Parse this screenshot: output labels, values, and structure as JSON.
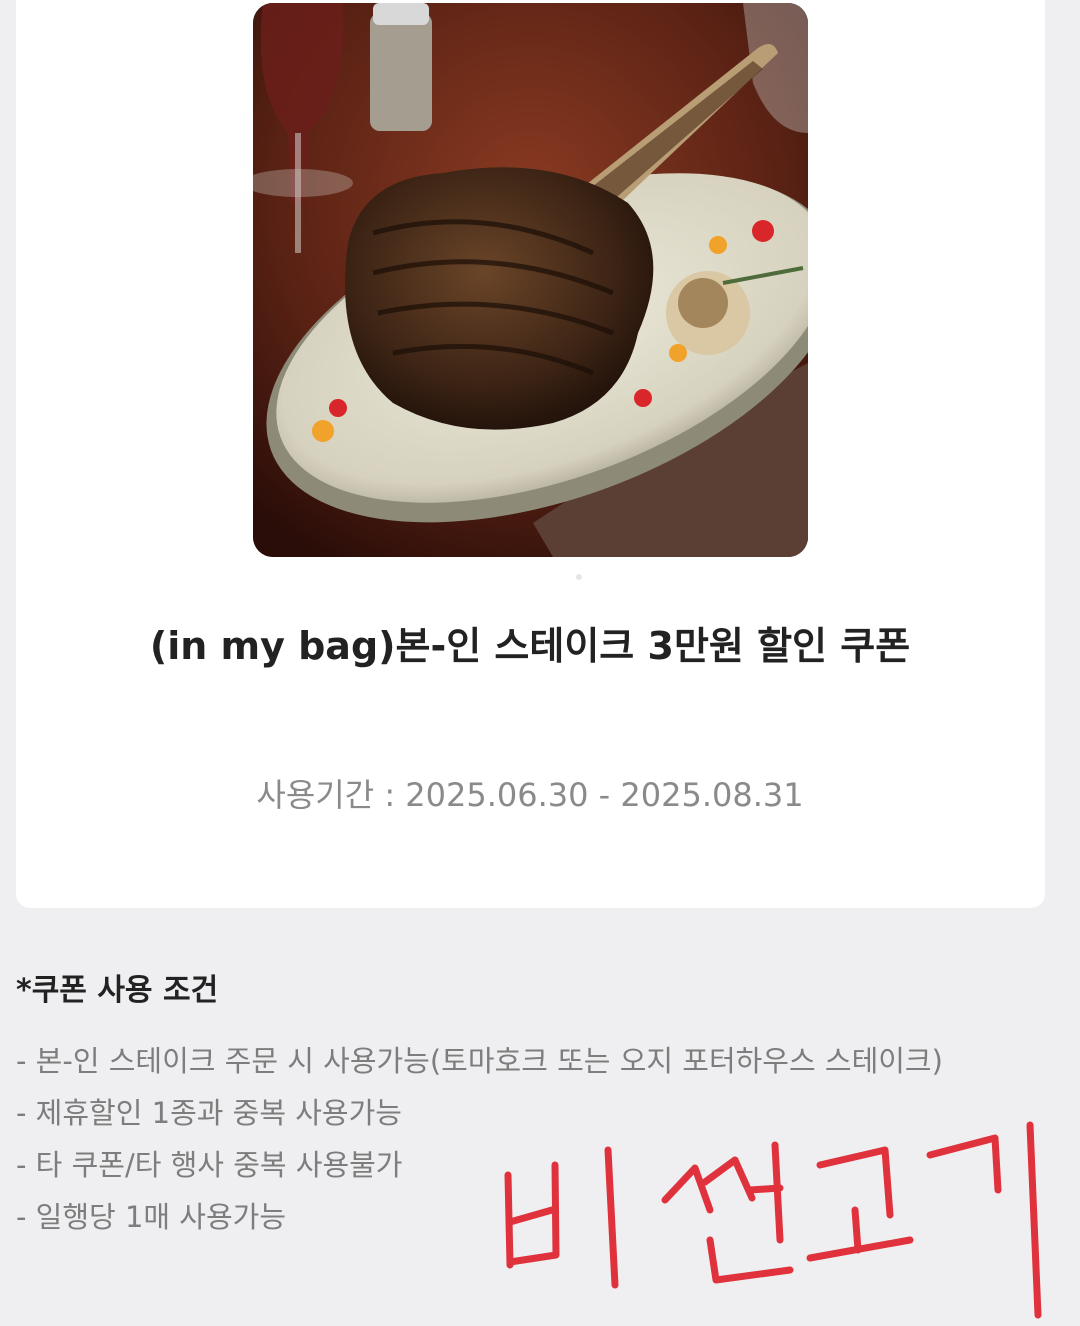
{
  "coupon": {
    "image_alt": "Tomahawk bone-in steak on a plate",
    "title": "(in my bag)본-인 스테이크 3만원 할인 쿠폰",
    "period_label": "사용기간 : 2025.06.30 - 2025.08.31"
  },
  "conditions": {
    "heading": "*쿠폰 사용 조건",
    "items": [
      "- 본-인 스테이크 주문 시 사용가능(토마호크 또는 오지 포터하우스 스테이크)",
      "- 제휴할인 1종과 중복 사용가능",
      "- 타 쿠폰/타 행사 중복 사용불가",
      "- 일행당 1매 사용가능"
    ]
  },
  "annotation": {
    "handwritten_text": "비싼고기",
    "color": "#e0323c"
  },
  "colors": {
    "background": "#efeff1",
    "card": "#ffffff",
    "title_text": "#222222",
    "secondary_text": "#8a8a8a"
  }
}
